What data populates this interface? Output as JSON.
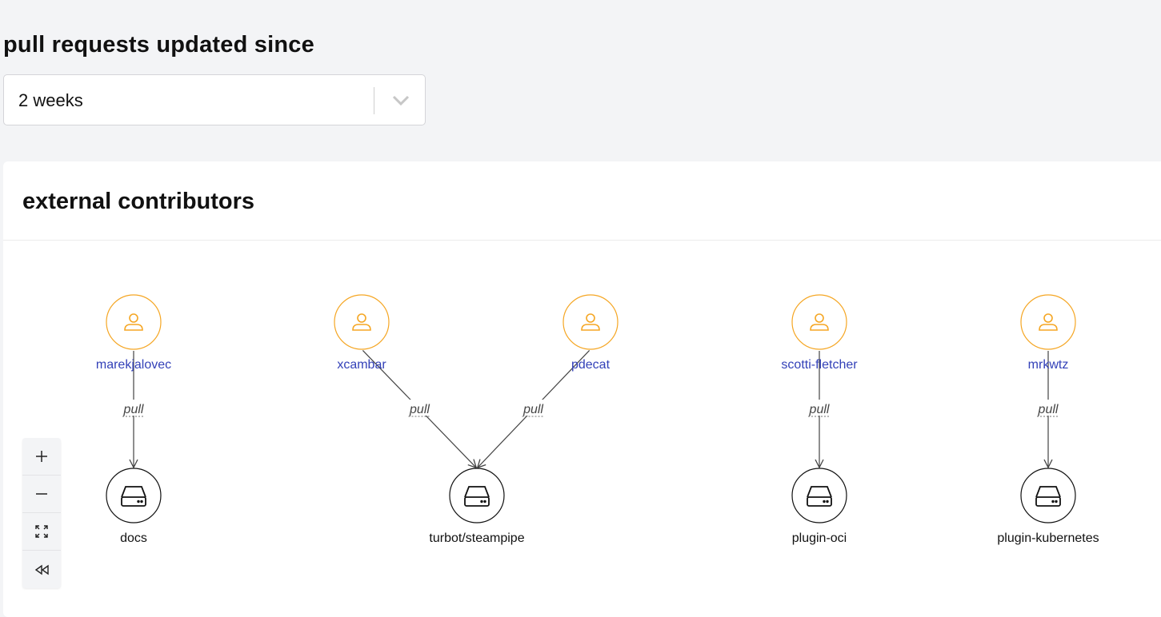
{
  "filter": {
    "title": "pull requests updated since",
    "selected": "2 weeks"
  },
  "card": {
    "title": "external contributors"
  },
  "graph": {
    "users": [
      {
        "id": "u1",
        "label": "marekjalovec"
      },
      {
        "id": "u2",
        "label": "xcambar"
      },
      {
        "id": "u3",
        "label": "pdecat"
      },
      {
        "id": "u4",
        "label": "scotti-fletcher"
      },
      {
        "id": "u5",
        "label": "mrkwtz"
      }
    ],
    "repos": [
      {
        "id": "r1",
        "label": "docs"
      },
      {
        "id": "r2",
        "label": "turbot/steampipe"
      },
      {
        "id": "r3",
        "label": "plugin-oci"
      },
      {
        "id": "r4",
        "label": "plugin-kubernetes"
      }
    ],
    "edges": [
      {
        "from": "u1",
        "to": "r1",
        "label": "pull"
      },
      {
        "from": "u2",
        "to": "r2",
        "label": "pull"
      },
      {
        "from": "u3",
        "to": "r2",
        "label": "pull"
      },
      {
        "from": "u4",
        "to": "r3",
        "label": "pull"
      },
      {
        "from": "u5",
        "to": "r4",
        "label": "pull"
      }
    ]
  },
  "zoom_controls": [
    "plus-icon",
    "minus-icon",
    "fit-view-icon",
    "reset-icon"
  ],
  "colors": {
    "user_node": "#f5a623",
    "user_label": "#3341b8",
    "repo_node": "#111111"
  }
}
